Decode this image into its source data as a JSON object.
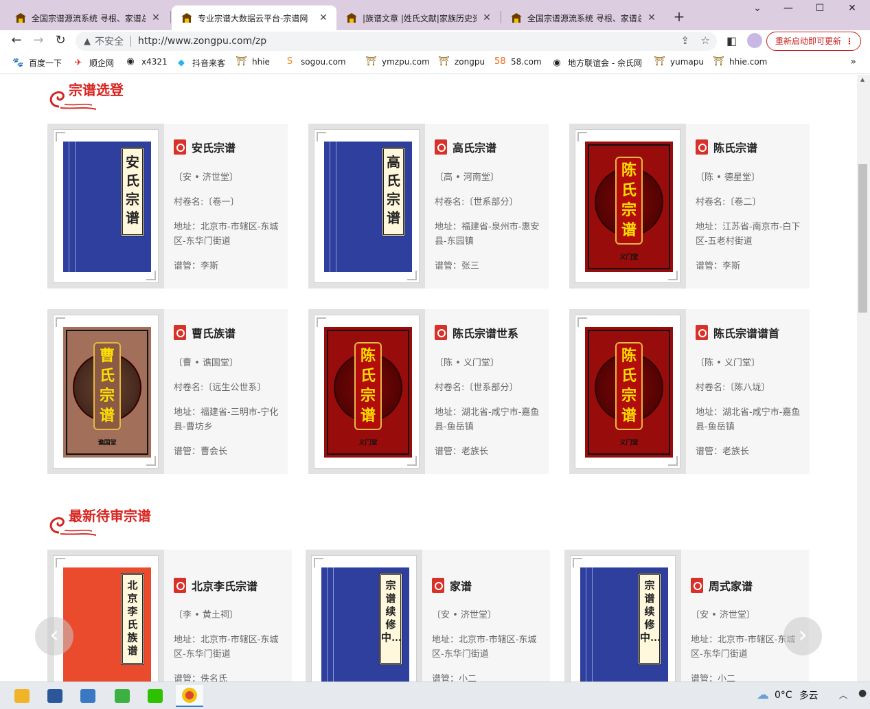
{
  "browser": {
    "tabs": [
      {
        "title": "全国宗谱源流系统 寻根、家谱总",
        "active": false
      },
      {
        "title": "专业宗谱大数据云平台-宗谱网",
        "active": true
      },
      {
        "title": "|族谱文章 |姓氏文献|家族历史资料",
        "active": false
      },
      {
        "title": "全国宗谱源流系统 寻根、家谱总",
        "active": false
      }
    ],
    "close_glyph": "✕",
    "new_tab_glyph": "+",
    "address": {
      "warning": "不安全",
      "url": "http://www.zongpu.com/zp"
    },
    "relaunch_label": "重新启动即可更新",
    "relaunch_menu": "⋮",
    "bookmarks": [
      {
        "label": "百度一下",
        "icon": "baidu-paw-icon",
        "glyph": "🐾",
        "color": "#2932e1"
      },
      {
        "label": "顺企网",
        "icon": "shunqi-icon",
        "glyph": "✈",
        "color": "#e02020"
      },
      {
        "label": "x4321",
        "icon": "globe-icon",
        "glyph": "◉",
        "color": "#222"
      },
      {
        "label": "抖音来客",
        "icon": "douyin-icon",
        "glyph": "◆",
        "color": "#2ab4e8"
      },
      {
        "label": "hhie",
        "icon": "zongpu-temple-icon",
        "glyph": "⛩",
        "color": "#8a5a00"
      },
      {
        "label": "sogou.com",
        "icon": "sogou-icon",
        "glyph": "S",
        "color": "#f28a17"
      },
      {
        "label": "ymzpu.com",
        "icon": "zongpu-temple-icon",
        "glyph": "⛩",
        "color": "#8a5a00"
      },
      {
        "label": "zongpu",
        "icon": "zongpu-temple-icon",
        "glyph": "⛩",
        "color": "#8a5a00"
      },
      {
        "label": "58.com",
        "icon": "58-icon",
        "glyph": "58",
        "color": "#f06a1d"
      },
      {
        "label": "地方联谊会 - 佘氏网",
        "icon": "globe-icon",
        "glyph": "◉",
        "color": "#222"
      },
      {
        "label": "yumapu",
        "icon": "zongpu-temple-icon",
        "glyph": "⛩",
        "color": "#8a5a00"
      },
      {
        "label": "hhie.com",
        "icon": "zongpu-temple-icon",
        "glyph": "⛩",
        "color": "#8a5a00"
      }
    ]
  },
  "sections": {
    "featured": {
      "title": "宗谱选登",
      "cards": [
        {
          "cover_title": "安氏宗谱",
          "cover_style": "blue",
          "name": "安氏宗谱",
          "hall": "〔安 • 济世堂〕",
          "volume": "村卷名:〔卷一〕",
          "address": "地址：北京市-市辖区-东城区-东华门街道",
          "manager": "谱管：李斯"
        },
        {
          "cover_title": "高氏宗谱",
          "cover_style": "blue",
          "name": "高氏宗谱",
          "hall": "〔高 • 河南堂〕",
          "volume": "村卷名:〔世系部分〕",
          "address": "地址：福建省-泉州市-惠安县-东园镇",
          "manager": "谱管：张三"
        },
        {
          "cover_title": "陈氏宗谱",
          "cover_style": "red",
          "cover_hall": "义门堂",
          "name": "陈氏宗谱",
          "hall": "〔陈 • 德星堂〕",
          "volume": "村卷名:〔卷二〕",
          "address": "地址：江苏省-南京市-白下区-五老村街道",
          "manager": "谱管：李斯"
        },
        {
          "cover_title": "曹氏宗谱",
          "cover_style": "brown",
          "cover_hall": "谯国堂",
          "name": "曹氏族谱",
          "hall": "〔曹 • 谯国堂〕",
          "volume": "村卷名:〔远生公世系〕",
          "address": "地址：福建省-三明市-宁化县-曹坊乡",
          "manager": "谱管：曹会长"
        },
        {
          "cover_title": "陈氏宗谱",
          "cover_style": "red",
          "cover_hall": "义门堂",
          "name": "陈氏宗谱世系",
          "hall": "〔陈 • 义门堂〕",
          "volume": "村卷名:〔世系部分〕",
          "address": "地址：湖北省-咸宁市-嘉鱼县-鱼岳镇",
          "manager": "谱管：老族长"
        },
        {
          "cover_title": "陈氏宗谱",
          "cover_style": "red",
          "cover_hall": "义门堂",
          "name": "陈氏宗谱谱首",
          "hall": "〔陈 • 义门堂〕",
          "volume": "村卷名:〔陈八垅〕",
          "address": "地址：湖北省-咸宁市-嘉鱼县-鱼岳镇",
          "manager": "谱管：老族长"
        }
      ]
    },
    "pending": {
      "title": "最新待审宗谱",
      "cards": [
        {
          "cover_title": "北京李氏族谱",
          "cover_style": "orange",
          "name": "北京李氏宗谱",
          "hall": "〔李 • 黄土祠〕",
          "address": "地址：北京市-市辖区-东城区-东华门街道",
          "manager": "谱管：佚名氏"
        },
        {
          "cover_title": "宗谱续修中…",
          "cover_style": "blue",
          "name": "家谱",
          "hall": "〔安 • 济世堂〕",
          "address": "地址：北京市-市辖区-东城区-东华门街道",
          "manager": "谱管：小二"
        },
        {
          "cover_title": "宗谱续修中…",
          "cover_style": "blue",
          "name": "周式家谱",
          "hall": "〔安 • 济世堂〕",
          "address": "地址：北京市-市辖区-东城区-东华门街道",
          "manager": "谱管：小二"
        }
      ],
      "prev_glyph": "‹",
      "next_glyph": "›"
    }
  },
  "taskbar": {
    "apps": [
      {
        "name": "file-explorer",
        "color": "#f0b429"
      },
      {
        "name": "word",
        "color": "#2b579a"
      },
      {
        "name": "control-panel",
        "color": "#3a78c4"
      },
      {
        "name": "browser-360",
        "color": "#3cb043"
      },
      {
        "name": "wechat",
        "color": "#2dc100"
      },
      {
        "name": "chrome",
        "color": "#db4437"
      }
    ],
    "weather": {
      "temp": "0°C",
      "condition": "多云"
    }
  }
}
